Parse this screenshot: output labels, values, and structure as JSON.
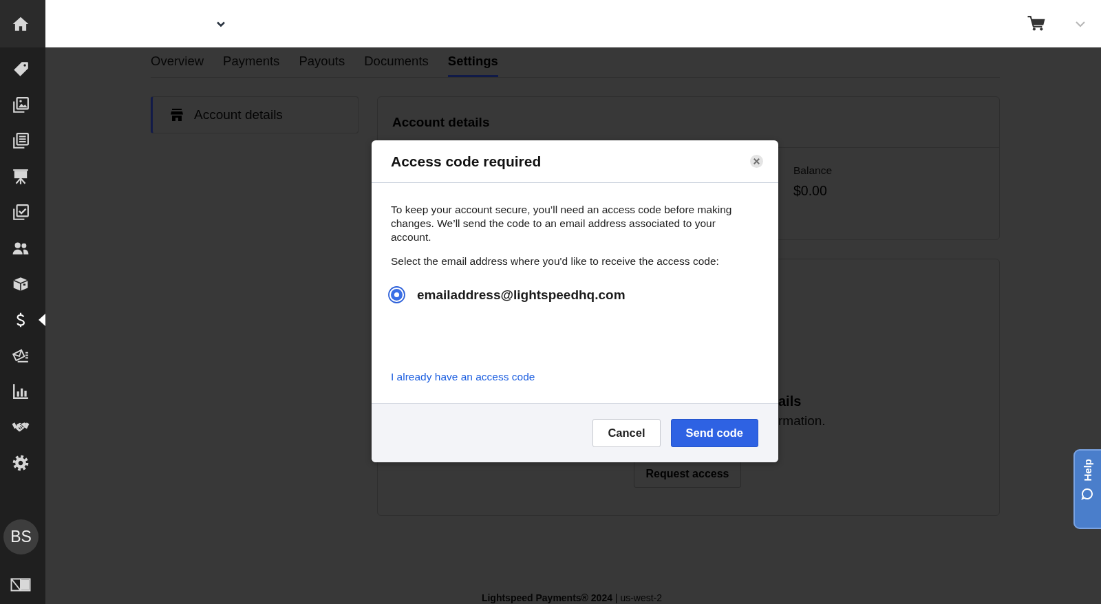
{
  "sidebar": {
    "items": [
      {
        "selected": false
      },
      {
        "selected": false
      },
      {
        "selected": false
      },
      {
        "selected": false
      },
      {
        "selected": false
      },
      {
        "selected": false
      },
      {
        "selected": false
      },
      {
        "selected": true
      },
      {
        "selected": false
      },
      {
        "selected": false
      },
      {
        "selected": false
      },
      {
        "selected": false
      }
    ]
  },
  "avatar": {
    "initials": "BS"
  },
  "tabs": [
    {
      "label": "Overview",
      "selected": false
    },
    {
      "label": "Payments",
      "selected": false
    },
    {
      "label": "Payouts",
      "selected": false
    },
    {
      "label": "Documents",
      "selected": false
    },
    {
      "label": "Settings",
      "selected": true
    }
  ],
  "settings_nav": {
    "items": [
      {
        "label": "Account details",
        "selected": true
      }
    ]
  },
  "account_card": {
    "title": "Account details",
    "balance_label": "Balance",
    "balance_value": "$0.00"
  },
  "access_card": {
    "heading": "ails",
    "text": "rmation.",
    "button": "Request access"
  },
  "modal": {
    "title": "Access code required",
    "paragraphs": [
      "To keep your account secure, you’ll need an access code before making changes. We’ll send the code to an email address associated to your account.",
      "Select the email address where you'd like to receive the access code:"
    ],
    "email_options": [
      {
        "address": "emailaddress@lightspeedhq.com",
        "selected": true
      }
    ],
    "link": "I already have an access code",
    "buttons": [
      {
        "label": "Cancel",
        "kind": "secondary"
      },
      {
        "label": "Send code",
        "kind": "primary"
      }
    ]
  },
  "help_tab": {
    "label": "Help"
  },
  "footer": "**Lightspeed Payments® 2024** | us-west-2"
}
